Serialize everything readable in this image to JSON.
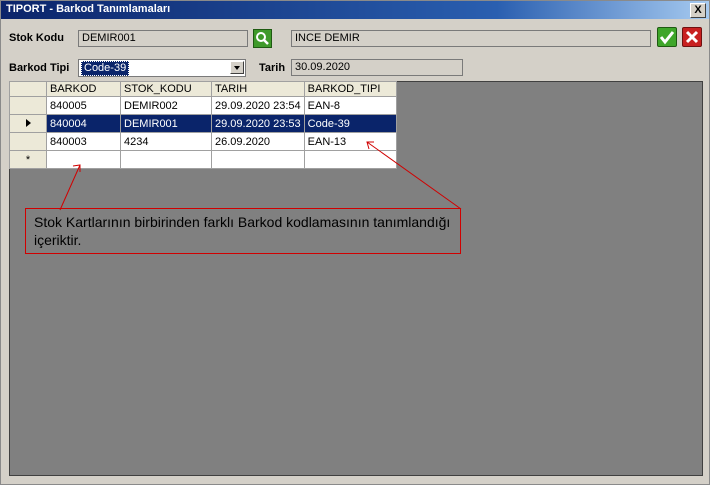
{
  "window": {
    "title": "TIPORT - Barkod Tanımlamaları",
    "close_label": "X"
  },
  "form": {
    "stok_kodu_label": "Stok Kodu",
    "stok_kodu_value": "DEMIR001",
    "stok_adi_value": "INCE DEMIR",
    "barkod_tipi_label": "Barkod Tipi",
    "barkod_tipi_value": "Code-39",
    "tarih_label": "Tarih",
    "tarih_value": "30.09.2020"
  },
  "grid": {
    "columns": [
      "BARKOD",
      "STOK_KODU",
      "TARIH",
      "BARKOD_TIPI"
    ],
    "rows": [
      [
        "840005",
        "DEMIR002",
        "29.09.2020 23:54",
        "EAN-8"
      ],
      [
        "840004",
        "DEMIR001",
        "29.09.2020 23:53",
        "Code-39"
      ],
      [
        "840003",
        "4234",
        "26.09.2020",
        "EAN-13"
      ]
    ],
    "new_row_marker": "*"
  },
  "annotation": {
    "text": "Stok Kartlarının birbirinden farklı Barkod kodlamasının tanımlandığı içeriktir.",
    "color": "#d00000"
  },
  "icons": {
    "search": "search-icon",
    "confirm": "checkmark-icon",
    "cancel": "close-icon"
  }
}
